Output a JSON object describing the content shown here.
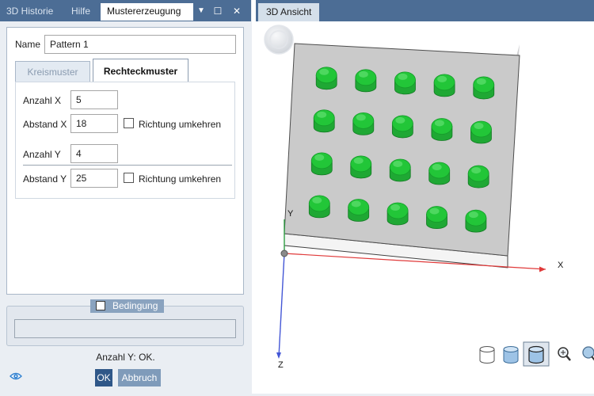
{
  "left_tabs": [
    {
      "label": "3D Historie",
      "active": false
    },
    {
      "label": "Hilfe",
      "active": false
    },
    {
      "label": "Mustererzeugung",
      "active": true
    }
  ],
  "window_controls": {
    "menu": "▼",
    "maximize": "☐",
    "close": "✕"
  },
  "form": {
    "name_label": "Name",
    "name_value": "Pattern 1",
    "pattern_tabs": [
      {
        "label": "Kreismuster",
        "active": false
      },
      {
        "label": "Rechteckmuster",
        "active": true
      }
    ],
    "anzahl_x_label": "Anzahl X",
    "anzahl_x_value": "5",
    "abstand_x_label": "Abstand X",
    "abstand_x_value": "18",
    "reverse_x_label": "Richtung umkehren",
    "reverse_x_checked": false,
    "anzahl_y_label": "Anzahl Y",
    "anzahl_y_value": "4",
    "abstand_y_label": "Abstand Y",
    "abstand_y_value": "25",
    "reverse_y_label": "Richtung umkehren",
    "reverse_y_checked": false
  },
  "condition": {
    "label": "Bedingung",
    "checked": false,
    "value": ""
  },
  "status_text": "Anzahl Y: OK.",
  "buttons": {
    "ok": "OK",
    "cancel": "Abbruch"
  },
  "right_tabs": [
    {
      "label": "3D Ansicht",
      "active": true
    }
  ],
  "viewport": {
    "axis_labels": {
      "x": "X",
      "y": "Y",
      "z": "Z"
    },
    "pattern": {
      "columns": 5,
      "rows": 4
    },
    "toolbar_icons": [
      "cylinder-outline-icon",
      "cylinder-filled-icon",
      "cylinder-shaded-icon",
      "zoom-icon",
      "view-rotate-icon"
    ],
    "colors": {
      "accent": "#4c6d95",
      "axis_x": "#e03a3a",
      "axis_y": "#2ea043",
      "axis_z": "#4457d6",
      "feature": "#22c638"
    }
  }
}
